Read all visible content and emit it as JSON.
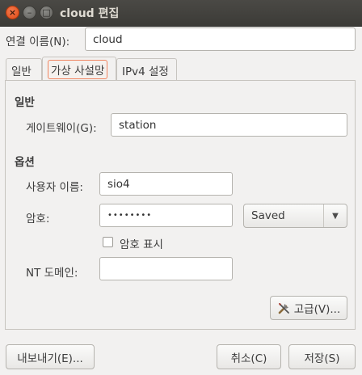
{
  "window": {
    "title": "cloud 편집"
  },
  "connection": {
    "label": "연결 이름(N):",
    "value": "cloud"
  },
  "tabs": [
    {
      "label": "일반"
    },
    {
      "label": "가상 사설망"
    },
    {
      "label": "IPv4 설정"
    }
  ],
  "general": {
    "heading": "일반",
    "gateway_label": "게이트웨이(G):",
    "gateway_value": "station"
  },
  "options": {
    "heading": "옵션",
    "username_label": "사용자 이름:",
    "username_value": "sio4",
    "password_label": "암호:",
    "password_value": "••••••••",
    "password_mode": "Saved",
    "show_password_label": "암호 표시",
    "show_password_checked": false,
    "nt_domain_label": "NT 도메인:",
    "nt_domain_value": ""
  },
  "advanced_button": "고급(V)...",
  "footer": {
    "export": "내보내기(E)...",
    "cancel": "취소(C)",
    "save": "저장(S)"
  }
}
